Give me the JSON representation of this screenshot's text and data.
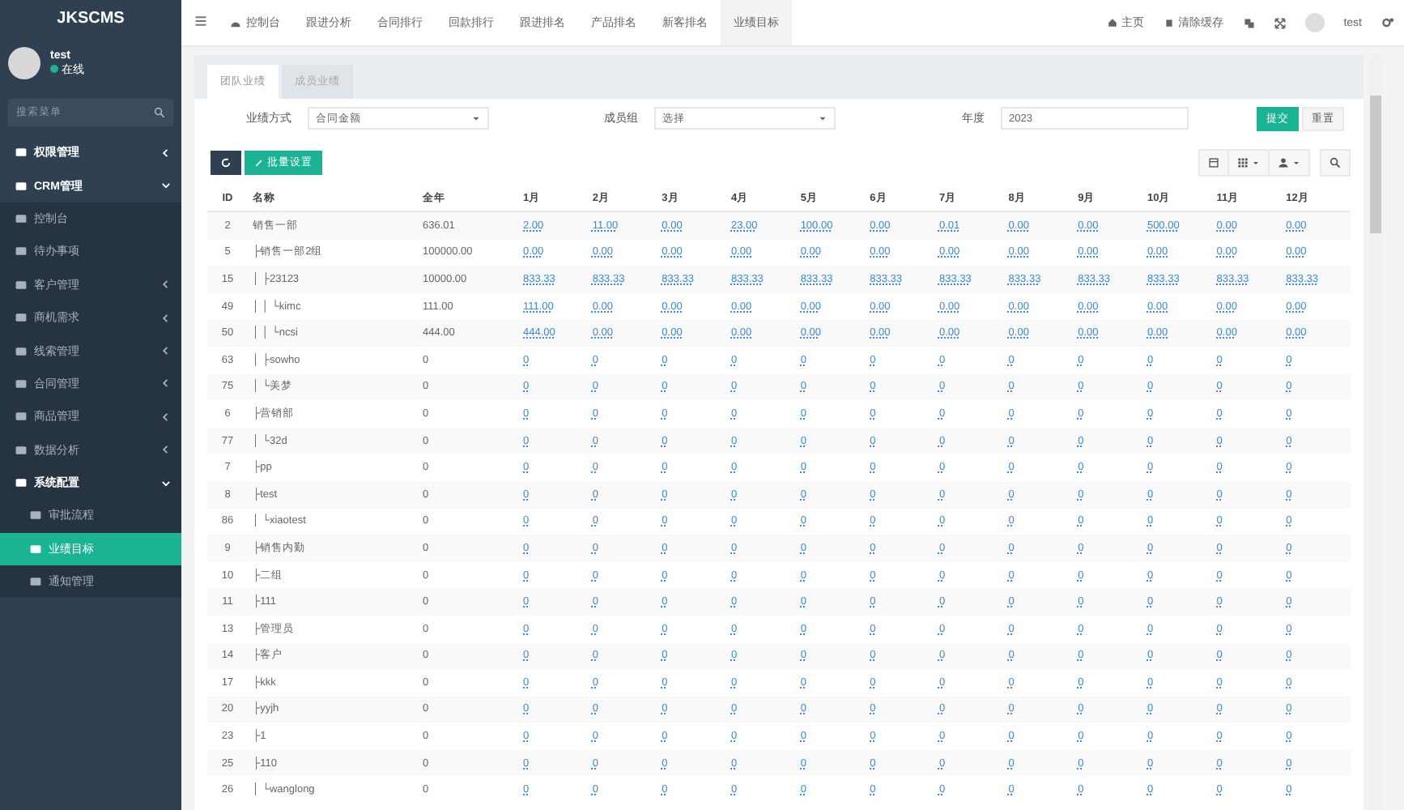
{
  "sidebar": {
    "logo": "JKSCMS",
    "user": {
      "name": "test",
      "status": "在线"
    },
    "search": {
      "placeholder": "搜索菜单"
    },
    "items": [
      {
        "label": "权限管理",
        "selected": false,
        "expanded": false
      },
      {
        "label": "CRM管理",
        "selected": false,
        "expanded": true,
        "children": [
          {
            "label": "控制台",
            "selected": false
          },
          {
            "label": "待办事项",
            "selected": false
          },
          {
            "label": "客户管理",
            "selected": false,
            "expanded": false
          },
          {
            "label": "商机需求",
            "selected": false,
            "expanded": false
          },
          {
            "label": "线索管理",
            "selected": false,
            "expanded": false
          },
          {
            "label": "合同管理",
            "selected": false,
            "expanded": false
          },
          {
            "label": "商品管理",
            "selected": false,
            "expanded": false
          },
          {
            "label": "数据分析",
            "selected": false,
            "expanded": false
          },
          {
            "label": "系统配置",
            "selected": false,
            "expanded": true,
            "children": [
              {
                "label": "审批流程",
                "selected": false
              },
              {
                "label": "业绩目标",
                "selected": true
              },
              {
                "label": "通知管理",
                "selected": false
              }
            ]
          }
        ]
      }
    ]
  },
  "topnav": {
    "tabs": [
      {
        "label": "控制台",
        "selected": false
      },
      {
        "label": "跟进分析",
        "selected": false
      },
      {
        "label": "合同排行",
        "selected": false
      },
      {
        "label": "回款排行",
        "selected": false
      },
      {
        "label": "跟进排名",
        "selected": false
      },
      {
        "label": "产品排名",
        "selected": false
      },
      {
        "label": "新客排名",
        "selected": false
      },
      {
        "label": "业绩目标",
        "selected": true
      }
    ],
    "home": "主页",
    "clear_cache": "清除缓存",
    "user": "test"
  },
  "panel": {
    "tabs": [
      {
        "label": "团队业绩",
        "selected": true
      },
      {
        "label": "成员业绩",
        "selected": false
      }
    ],
    "filters": [
      {
        "label": "业绩方式",
        "kind": "select",
        "value": "合同金额"
      },
      {
        "label": "成员组",
        "kind": "select",
        "value": "选择"
      },
      {
        "label": "年度",
        "kind": "input",
        "value": "2023"
      }
    ],
    "actions": [
      {
        "label": "提交",
        "kind": "primary"
      },
      {
        "label": "重置",
        "kind": "default"
      }
    ],
    "toolbar": [
      {
        "kind": "refresh"
      },
      {
        "kind": "edit",
        "label": "批量设置"
      }
    ],
    "table": {
      "columns": [
        "ID",
        "名称",
        "全年",
        "1月",
        "2月",
        "3月",
        "4月",
        "5月",
        "6月",
        "7月",
        "8月",
        "9月",
        "10月",
        "11月",
        "12月"
      ],
      "rows": [
        {
          "id": "2",
          "name": "销售一部",
          "year": "636.01",
          "months": [
            "2.00",
            "11.00",
            "0.00",
            "23.00",
            "100.00",
            "0.00",
            "0.01",
            "0.00",
            "0.00",
            "500.00",
            "0.00",
            "0.00"
          ]
        },
        {
          "id": "5",
          "name": "├销售一部2组",
          "year": "100000.00",
          "months": [
            "0.00",
            "0.00",
            "0.00",
            "0.00",
            "0.00",
            "0.00",
            "0.00",
            "0.00",
            "0.00",
            "0.00",
            "0.00",
            "0.00"
          ]
        },
        {
          "id": "15",
          "name": "│ ├23123",
          "year": "10000.00",
          "months": [
            "833.33",
            "833.33",
            "833.33",
            "833.33",
            "833.33",
            "833.33",
            "833.33",
            "833.33",
            "833.33",
            "833.33",
            "833.33",
            "833.33"
          ]
        },
        {
          "id": "49",
          "name": "│ │ └kimc",
          "year": "111.00",
          "months": [
            "111.00",
            "0.00",
            "0.00",
            "0.00",
            "0.00",
            "0.00",
            "0.00",
            "0.00",
            "0.00",
            "0.00",
            "0.00",
            "0.00"
          ]
        },
        {
          "id": "50",
          "name": "│ │   └ncsi",
          "year": "444.00",
          "months": [
            "444.00",
            "0.00",
            "0.00",
            "0.00",
            "0.00",
            "0.00",
            "0.00",
            "0.00",
            "0.00",
            "0.00",
            "0.00",
            "0.00"
          ]
        },
        {
          "id": "63",
          "name": "│ ├sowho",
          "year": "0",
          "months": [
            "0",
            "0",
            "0",
            "0",
            "0",
            "0",
            "0",
            "0",
            "0",
            "0",
            "0",
            "0"
          ]
        },
        {
          "id": "75",
          "name": "│ └美梦",
          "year": "0",
          "months": [
            "0",
            "0",
            "0",
            "0",
            "0",
            "0",
            "0",
            "0",
            "0",
            "0",
            "0",
            "0"
          ]
        },
        {
          "id": "6",
          "name": "├营销部",
          "year": "0",
          "months": [
            "0",
            "0",
            "0",
            "0",
            "0",
            "0",
            "0",
            "0",
            "0",
            "0",
            "0",
            "0"
          ]
        },
        {
          "id": "77",
          "name": "│ └32d",
          "year": "0",
          "months": [
            "0",
            "0",
            "0",
            "0",
            "0",
            "0",
            "0",
            "0",
            "0",
            "0",
            "0",
            "0"
          ]
        },
        {
          "id": "7",
          "name": "├pp",
          "year": "0",
          "months": [
            "0",
            "0",
            "0",
            "0",
            "0",
            "0",
            "0",
            "0",
            "0",
            "0",
            "0",
            "0"
          ]
        },
        {
          "id": "8",
          "name": "├test",
          "year": "0",
          "months": [
            "0",
            "0",
            "0",
            "0",
            "0",
            "0",
            "0",
            "0",
            "0",
            "0",
            "0",
            "0"
          ]
        },
        {
          "id": "86",
          "name": "│ └xiaotest",
          "year": "0",
          "months": [
            "0",
            "0",
            "0",
            "0",
            "0",
            "0",
            "0",
            "0",
            "0",
            "0",
            "0",
            "0"
          ]
        },
        {
          "id": "9",
          "name": "├销售内勤",
          "year": "0",
          "months": [
            "0",
            "0",
            "0",
            "0",
            "0",
            "0",
            "0",
            "0",
            "0",
            "0",
            "0",
            "0"
          ]
        },
        {
          "id": "10",
          "name": "├二组",
          "year": "0",
          "months": [
            "0",
            "0",
            "0",
            "0",
            "0",
            "0",
            "0",
            "0",
            "0",
            "0",
            "0",
            "0"
          ]
        },
        {
          "id": "11",
          "name": "├111",
          "year": "0",
          "months": [
            "0",
            "0",
            "0",
            "0",
            "0",
            "0",
            "0",
            "0",
            "0",
            "0",
            "0",
            "0"
          ]
        },
        {
          "id": "13",
          "name": "├管理员",
          "year": "0",
          "months": [
            "0",
            "0",
            "0",
            "0",
            "0",
            "0",
            "0",
            "0",
            "0",
            "0",
            "0",
            "0"
          ]
        },
        {
          "id": "14",
          "name": "├客户",
          "year": "0",
          "months": [
            "0",
            "0",
            "0",
            "0",
            "0",
            "0",
            "0",
            "0",
            "0",
            "0",
            "0",
            "0"
          ]
        },
        {
          "id": "17",
          "name": "├kkk",
          "year": "0",
          "months": [
            "0",
            "0",
            "0",
            "0",
            "0",
            "0",
            "0",
            "0",
            "0",
            "0",
            "0",
            "0"
          ]
        },
        {
          "id": "20",
          "name": "├yyjh",
          "year": "0",
          "months": [
            "0",
            "0",
            "0",
            "0",
            "0",
            "0",
            "0",
            "0",
            "0",
            "0",
            "0",
            "0"
          ]
        },
        {
          "id": "23",
          "name": "├1",
          "year": "0",
          "months": [
            "0",
            "0",
            "0",
            "0",
            "0",
            "0",
            "0",
            "0",
            "0",
            "0",
            "0",
            "0"
          ]
        },
        {
          "id": "25",
          "name": "├110",
          "year": "0",
          "months": [
            "0",
            "0",
            "0",
            "0",
            "0",
            "0",
            "0",
            "0",
            "0",
            "0",
            "0",
            "0"
          ]
        },
        {
          "id": "26",
          "name": "│ └wanglong",
          "year": "0",
          "months": [
            "0",
            "0",
            "0",
            "0",
            "0",
            "0",
            "0",
            "0",
            "0",
            "0",
            "0",
            "0"
          ]
        }
      ]
    }
  }
}
